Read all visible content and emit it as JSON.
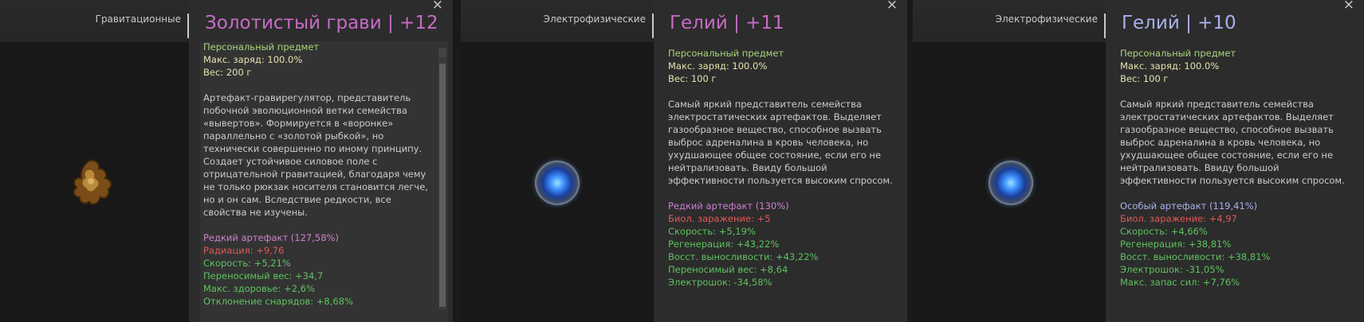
{
  "panels": [
    {
      "category": "Гравитационные",
      "title": "Золотистый грави | +12",
      "title_color": "#c66cc6",
      "personal": "Персональный предмет",
      "charge": "Макс. заряд: 100.0%",
      "weight": "Вес: 200 г",
      "description": "Артефакт-гравирегулятор, представитель побочной эволюционной ветки семейства «вывертов». Формируется в «воронке» параллельно с «золотой рыбкой», но технически совершенно по иному принципу. Создает устойчивое силовое поле с отрицательной гравитацией, благодаря чему не только рюкзак носителя становится легче, но и он сам. Вследствие редкости, все свойства не изучены.",
      "rarity": "Редкий артефакт (127,58%)",
      "stats": [
        {
          "text": "Радиация: +9,76",
          "kind": "bad"
        },
        {
          "text": "Скорость: +5,21%",
          "kind": "good"
        },
        {
          "text": "Переносимый вес: +34,7",
          "kind": "good"
        },
        {
          "text": "Макс. здоровье: +2,6%",
          "kind": "good"
        },
        {
          "text": "Отклонение снарядов: +8,68%",
          "kind": "good"
        }
      ],
      "artifact_icon": "gravi-artifact-icon"
    },
    {
      "category": "Электрофизические",
      "title": "Гелий | +11",
      "title_color": "#c66cc6",
      "personal": "Персональный предмет",
      "charge": "Макс. заряд: 100.0%",
      "weight": "Вес: 100 г",
      "description": "Самый яркий представитель семейства электростатических артефактов. Выделяет газообразное вещество, способное вызвать выброс адреналина в кровь человека, но ухудшающее общее состояние, если его не нейтрализовать. Ввиду большой эффективности пользуется высоким спросом.",
      "rarity": "Редкий артефакт (130%)",
      "stats": [
        {
          "text": "Биол. заражение: +5",
          "kind": "bad"
        },
        {
          "text": "Скорость: +5,19%",
          "kind": "good"
        },
        {
          "text": "Регенерация: +43,22%",
          "kind": "good"
        },
        {
          "text": "Восст. выносливости: +43,22%",
          "kind": "good"
        },
        {
          "text": "Переносимый вес: +8,64",
          "kind": "good"
        },
        {
          "text": "Электрошок: -34,58%",
          "kind": "good"
        }
      ],
      "artifact_icon": "helium-orb-icon"
    },
    {
      "category": "Электрофизические",
      "title": "Гелий | +10",
      "title_color": "#aab0ef",
      "personal": "Персональный предмет",
      "charge": "Макс. заряд: 100.0%",
      "weight": "Вес: 100 г",
      "description": "Самый яркий представитель семейства электростатических артефактов. Выделяет газообразное вещество, способное вызвать выброс адреналина в кровь человека, но ухудшающее общее состояние, если его не нейтрализовать. Ввиду большой эффективности пользуется высоким спросом.",
      "rarity": "Особый артефакт (119,41%)",
      "stats": [
        {
          "text": "Биол. заражение: +4,97",
          "kind": "bad"
        },
        {
          "text": "Скорость: +4,66%",
          "kind": "good"
        },
        {
          "text": "Регенерация: +38,81%",
          "kind": "good"
        },
        {
          "text": "Восст. выносливости: +38,81%",
          "kind": "good"
        },
        {
          "text": "Электрошок: -31,05%",
          "kind": "good"
        },
        {
          "text": "Макс. запас сил: +7,76%",
          "kind": "good"
        }
      ],
      "artifact_icon": "helium-orb-icon"
    }
  ],
  "close_label": "×"
}
